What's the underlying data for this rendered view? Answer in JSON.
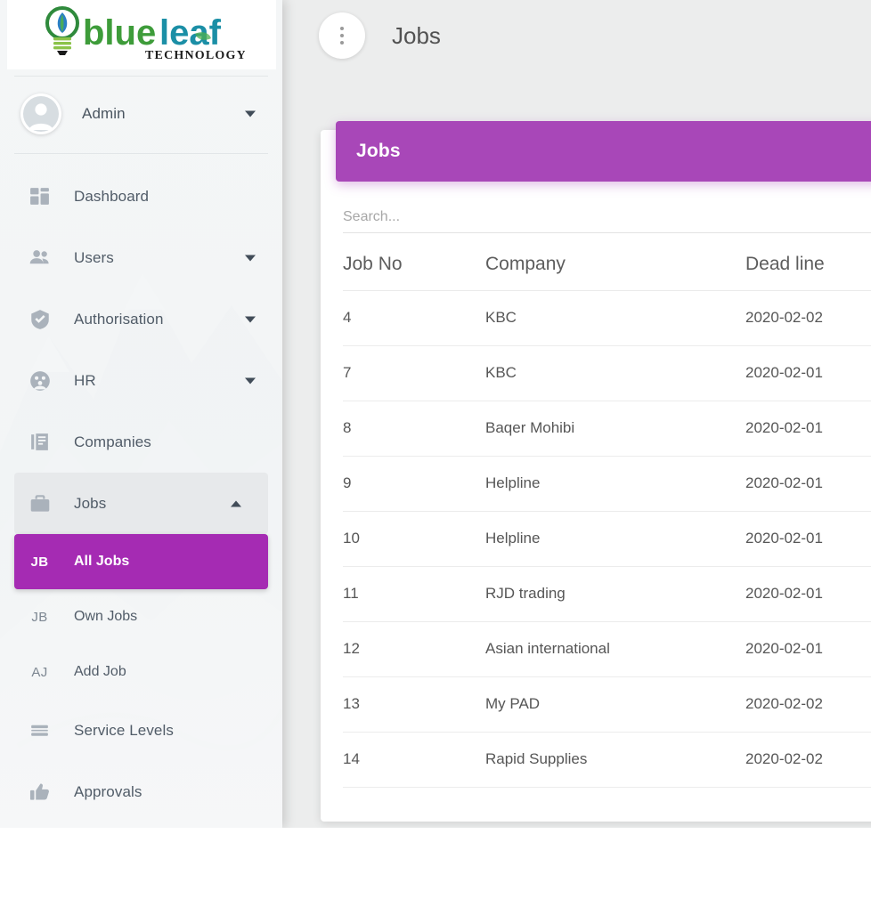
{
  "brand": {
    "name_part1": "blue",
    "name_part2": "leaf",
    "tagline": "TECHNOLOGY",
    "color_green": "#3e9c3a",
    "color_teal": "#1b8fa6"
  },
  "sidebar": {
    "user": {
      "name": "Admin",
      "caret": "chevron-down-icon"
    },
    "items": [
      {
        "label": "Dashboard",
        "icon": "dashboard-icon",
        "caret": null,
        "expanded": false
      },
      {
        "label": "Users",
        "icon": "users-icon",
        "caret": "chevron-down-icon",
        "expanded": false
      },
      {
        "label": "Authorisation",
        "icon": "shield-check-icon",
        "caret": "chevron-down-icon",
        "expanded": false
      },
      {
        "label": "HR",
        "icon": "people-circle-icon",
        "caret": "chevron-down-icon",
        "expanded": false
      },
      {
        "label": "Companies",
        "icon": "companies-icon",
        "caret": null,
        "expanded": false
      },
      {
        "label": "Jobs",
        "icon": "briefcase-icon",
        "caret": "chevron-up-icon",
        "expanded": true
      }
    ],
    "submenu": [
      {
        "abbr": "JB",
        "label": "All Jobs",
        "active": true
      },
      {
        "abbr": "JB",
        "label": "Own Jobs",
        "active": false
      },
      {
        "abbr": "AJ",
        "label": "Add Job",
        "active": false
      }
    ],
    "items_after": [
      {
        "label": "Service Levels",
        "icon": "service-levels-icon"
      },
      {
        "label": "Approvals",
        "icon": "thumbs-up-icon"
      }
    ],
    "active_color": "#a52bb3"
  },
  "topbar": {
    "menu_button_icon": "more-vertical-icon",
    "title": "Jobs"
  },
  "card": {
    "header_title": "Jobs",
    "header_color": "#a847b8",
    "search": {
      "value": "",
      "placeholder": "Search..."
    },
    "table": {
      "columns": [
        "Job No",
        "Company",
        "Dead line"
      ],
      "rows": [
        {
          "job_no": "4",
          "company": "KBC",
          "deadline": "2020-02-02"
        },
        {
          "job_no": "7",
          "company": "KBC",
          "deadline": "2020-02-01"
        },
        {
          "job_no": "8",
          "company": "Baqer Mohibi",
          "deadline": "2020-02-01"
        },
        {
          "job_no": "9",
          "company": "Helpline",
          "deadline": "2020-02-01"
        },
        {
          "job_no": "10",
          "company": "Helpline",
          "deadline": "2020-02-01"
        },
        {
          "job_no": "11",
          "company": "RJD trading",
          "deadline": "2020-02-01"
        },
        {
          "job_no": "12",
          "company": "Asian international",
          "deadline": "2020-02-01"
        },
        {
          "job_no": "13",
          "company": "My PAD",
          "deadline": "2020-02-02"
        },
        {
          "job_no": "14",
          "company": "Rapid Supplies",
          "deadline": "2020-02-02"
        }
      ]
    }
  }
}
